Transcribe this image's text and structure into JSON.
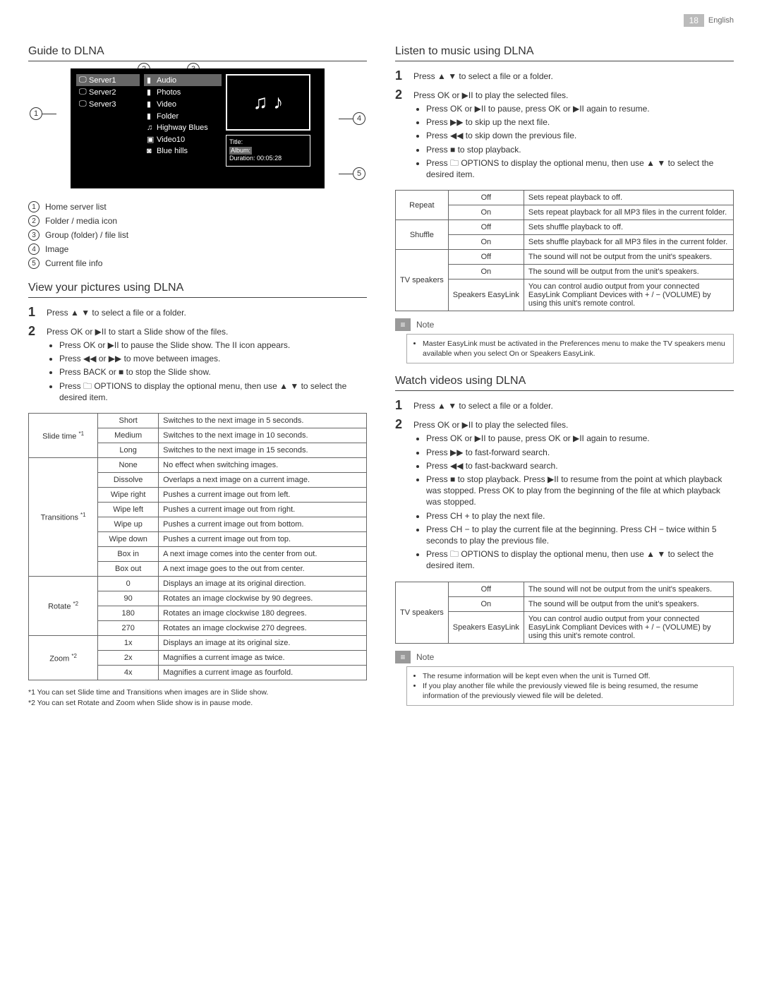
{
  "header": {
    "page": "18",
    "lang": "English"
  },
  "left": {
    "guide_title": "Guide to DLNA",
    "diagram": {
      "servers": [
        "Server1",
        "Server2",
        "Server3"
      ],
      "files": [
        "Audio",
        "Photos",
        "Video",
        "Folder",
        "Highway Blues",
        "Video10",
        "Blue hills"
      ],
      "info": {
        "title_label": "Title:",
        "album_label": "Album:",
        "dur_label": "Duration:",
        "dur": "00:05:28"
      }
    },
    "legend": [
      "Home server list",
      "Folder / media icon",
      "Group (folder) / file list",
      "Image",
      "Current file info"
    ],
    "pictures_title": "View your pictures using DLNA",
    "pic_step1": "Press ▲ ▼ to select a file or a folder.",
    "pic_step2": "Press OK or ▶II to start a Slide show of the files.",
    "pic_bullets": [
      "Press OK or ▶II to pause the Slide show. The II icon appears.",
      "Press ◀◀ or ▶▶ to move between images.",
      "Press BACK or ■ to stop the Slide show.",
      "Press 🗀 OPTIONS to display the optional menu, then use ▲ ▼ to select the desired item."
    ],
    "pictable": [
      {
        "setting": "Slide time *1",
        "rows": [
          {
            "v": "Short",
            "d": "Switches to the next image in 5 seconds."
          },
          {
            "v": "Medium",
            "d": "Switches to the next image in 10 seconds."
          },
          {
            "v": "Long",
            "d": "Switches to the next image in 15 seconds."
          }
        ]
      },
      {
        "setting": "Transitions *1",
        "rows": [
          {
            "v": "None",
            "d": "No effect when switching images."
          },
          {
            "v": "Dissolve",
            "d": "Overlaps a next image on a current image."
          },
          {
            "v": "Wipe right",
            "d": "Pushes a current image out from left."
          },
          {
            "v": "Wipe left",
            "d": "Pushes a current image out from right."
          },
          {
            "v": "Wipe up",
            "d": "Pushes a current image out from bottom."
          },
          {
            "v": "Wipe down",
            "d": "Pushes a current image out from top."
          },
          {
            "v": "Box in",
            "d": "A next image comes into the center from out."
          },
          {
            "v": "Box out",
            "d": "A next image goes to the out from center."
          }
        ]
      },
      {
        "setting": "Rotate *2",
        "rows": [
          {
            "v": "0",
            "d": "Displays an image at its original direction."
          },
          {
            "v": "90",
            "d": "Rotates an image clockwise by 90 degrees."
          },
          {
            "v": "180",
            "d": "Rotates an image clockwise 180 degrees."
          },
          {
            "v": "270",
            "d": "Rotates an image clockwise 270 degrees."
          }
        ]
      },
      {
        "setting": "Zoom *2",
        "rows": [
          {
            "v": "1x",
            "d": "Displays an image at its original size."
          },
          {
            "v": "2x",
            "d": "Magnifies a current image as twice."
          },
          {
            "v": "4x",
            "d": "Magnifies a current image as fourfold."
          }
        ]
      }
    ],
    "footnotes": [
      "*1 You can set Slide time and Transitions when images are in Slide show.",
      "*2 You can set Rotate and Zoom when Slide show is in pause mode."
    ]
  },
  "right": {
    "music_title": "Listen to music using DLNA",
    "music_step1": "Press ▲ ▼ to select a file or a folder.",
    "music_step2": "Press OK or ▶II to play the selected files.",
    "music_bullets": [
      "Press OK or ▶II to pause, press OK or ▶II again to resume.",
      "Press ▶▶ to skip up the next file.",
      "Press ◀◀ to skip down the previous file.",
      "Press ■ to stop playback.",
      "Press 🗀 OPTIONS to display the optional menu, then use ▲ ▼ to select the desired item."
    ],
    "musictable": [
      {
        "setting": "Repeat",
        "rows": [
          {
            "v": "Off",
            "d": "Sets repeat playback to off."
          },
          {
            "v": "On",
            "d": "Sets repeat playback for all MP3 files in the current folder."
          }
        ]
      },
      {
        "setting": "Shuffle",
        "rows": [
          {
            "v": "Off",
            "d": "Sets shuffle playback to off."
          },
          {
            "v": "On",
            "d": "Sets shuffle playback for all MP3 files in the current folder."
          }
        ]
      },
      {
        "setting": "TV speakers",
        "rows": [
          {
            "v": "Off",
            "d": "The sound will not be output from the unit's speakers."
          },
          {
            "v": "On",
            "d": "The sound will be output from the unit's speakers."
          },
          {
            "v": "Speakers EasyLink",
            "d": "You can control audio output from your connected EasyLink Compliant Devices with + / − (VOLUME) by using this unit's remote control."
          }
        ]
      }
    ],
    "music_note_label": "Note",
    "music_note": "Master EasyLink must be activated in the Preferences menu to make the TV speakers menu available when you select On or Speakers EasyLink.",
    "video_title": "Watch videos using DLNA",
    "video_step1": "Press ▲ ▼ to select a file or a folder.",
    "video_step2": "Press OK or ▶II to play the selected files.",
    "video_bullets": [
      "Press OK or ▶II to pause, press OK or ▶II again to resume.",
      "Press ▶▶ to fast-forward search.",
      "Press ◀◀ to fast-backward search.",
      "Press ■ to stop playback. Press ▶II to resume from the point at which playback was stopped. Press OK to play from the beginning of the file at which playback was stopped.",
      "Press CH + to play the next file.",
      "Press CH − to play the current file at the beginning. Press CH − twice within 5 seconds to play the previous file.",
      "Press 🗀 OPTIONS to display the optional menu, then use ▲ ▼ to select the desired item."
    ],
    "videotable": [
      {
        "setting": "TV speakers",
        "rows": [
          {
            "v": "Off",
            "d": "The sound will not be output from the unit's speakers."
          },
          {
            "v": "On",
            "d": "The sound will be output from the unit's speakers."
          },
          {
            "v": "Speakers EasyLink",
            "d": "You can control audio output from your connected EasyLink Compliant Devices with + / − (VOLUME) by using this unit's remote control."
          }
        ]
      }
    ],
    "video_note_label": "Note",
    "video_notes": [
      "The resume information will be kept even when the unit is Turned Off.",
      "If you play another file while the previously viewed file is being resumed, the resume information of the previously viewed file will be deleted."
    ]
  }
}
